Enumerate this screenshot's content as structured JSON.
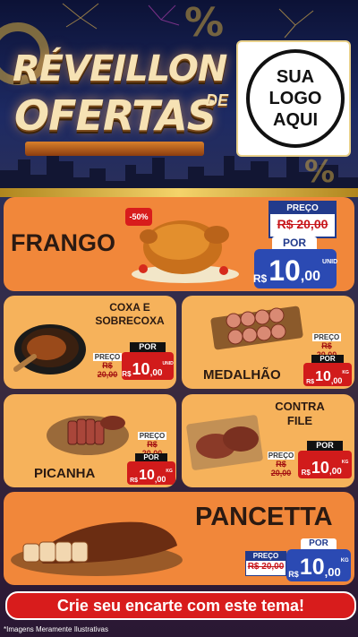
{
  "header": {
    "title_line1": "RÉVEILLON",
    "title_de": "DE",
    "title_line2": "OFERTAS",
    "logo_lines": [
      "SUA",
      "LOGO",
      "AQUI"
    ]
  },
  "products": [
    {
      "name": "FRANGO",
      "discount": "-50%",
      "preco_label": "PREÇO",
      "old_price": "R$ 20,00",
      "por_label": "POR",
      "currency": "R$",
      "price_int": "10",
      "price_dec": ",00",
      "unit": "UNID"
    },
    {
      "name": "COXA E SOBRECOXA",
      "name_line1": "COXA E",
      "name_line2": "SOBRECOXA",
      "preco_label": "PREÇO",
      "old_price": "R$ 20,00",
      "por_label": "POR",
      "currency": "R$",
      "price_int": "10",
      "price_dec": ",00",
      "unit": "UNID"
    },
    {
      "name": "MEDALHÃO",
      "preco_label": "PREÇO",
      "old_price": "R$ 20,00",
      "por_label": "POR",
      "currency": "R$",
      "price_int": "10",
      "price_dec": ",00",
      "unit": "KG"
    },
    {
      "name": "PICANHA",
      "preco_label": "PREÇO",
      "old_price": "R$ 20,00",
      "por_label": "POR",
      "currency": "R$",
      "price_int": "10",
      "price_dec": ",00",
      "unit": "KG"
    },
    {
      "name": "CONTRA FILE",
      "name_line1": "CONTRA",
      "name_line2": "FILE",
      "preco_label": "PREÇO",
      "old_price": "R$ 20,00",
      "por_label": "POR",
      "currency": "R$",
      "price_int": "10",
      "price_dec": ",00",
      "unit": "KG"
    },
    {
      "name": "PANCETTA",
      "preco_label": "PREÇO",
      "old_price": "R$ 20,00",
      "por_label": "POR",
      "currency": "R$",
      "price_int": "10",
      "price_dec": ",00",
      "unit": "KG"
    }
  ],
  "banner": "Crie seu encarte com este tema!",
  "footer_note": "*Imagens Meramente Ilustrativas",
  "colors": {
    "orange": "#f1873a",
    "peach": "#f6b25b",
    "price_red": "#d11b1b",
    "price_blue": "#2b4ab3",
    "gold": "#c7a240"
  }
}
